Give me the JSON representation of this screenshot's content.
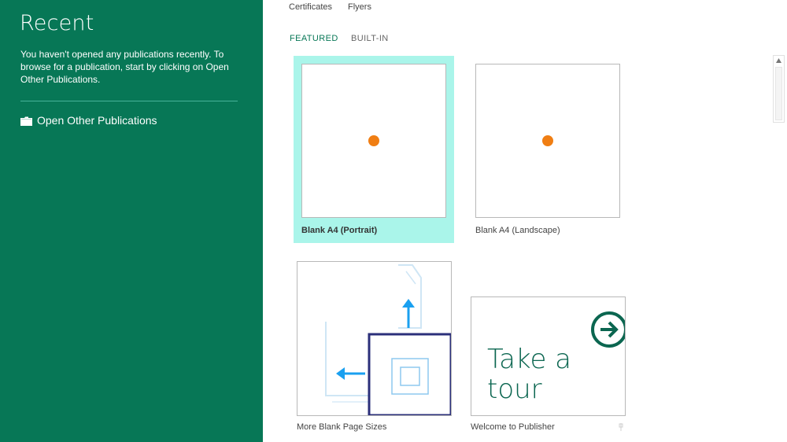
{
  "sidebar": {
    "title": "Recent",
    "message": "You haven't opened any publications recently. To browse for a publication, start by clicking on Open Other Publications.",
    "open_other_label": "Open Other Publications",
    "background_color": "#077756",
    "open_other_icon": "folder-icon"
  },
  "top_links": [
    "Certificates",
    "Flyers"
  ],
  "tabs": [
    {
      "label": "FEATURED",
      "selected": true
    },
    {
      "label": "BUILT-IN",
      "selected": false
    }
  ],
  "templates": [
    {
      "label": "Blank A4 (Portrait)",
      "selected": true
    },
    {
      "label": "Blank A4 (Landscape)",
      "selected": false
    },
    {
      "label": "More Blank Page Sizes",
      "selected": false
    },
    {
      "label": "Welcome to Publisher",
      "selected": false,
      "thumbnail_text": [
        "Take a",
        "tour"
      ],
      "icon": "arrow-circle-icon"
    }
  ],
  "colors": {
    "accent": "#077756",
    "selection": "#aaf5ea",
    "dot": "#f07e13",
    "diagram_blue": "#1aa0f0",
    "diagram_navy": "#2b2f7a"
  }
}
